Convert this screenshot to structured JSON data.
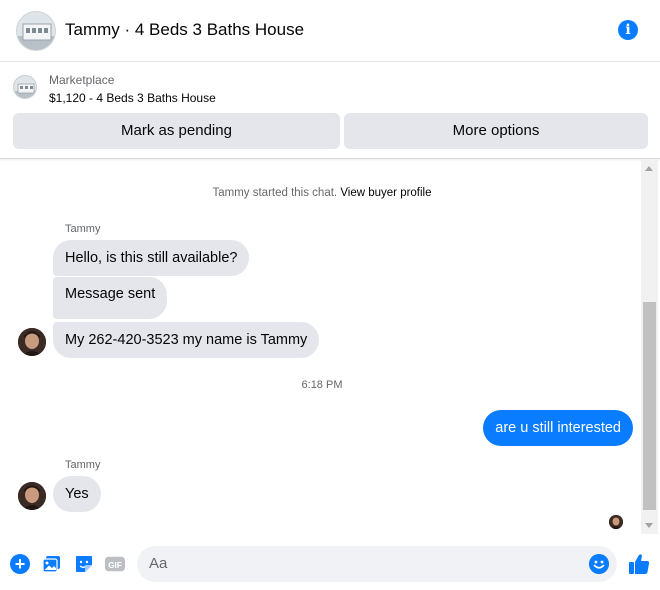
{
  "header": {
    "title": "Tammy · 4 Beds 3 Baths House",
    "avatar_icon": "house-photo",
    "info_icon": "info-icon",
    "info_glyph": "i"
  },
  "marketplace": {
    "label": "Marketplace",
    "listing": "$1,120 - 4 Beds 3 Baths House",
    "mark_pending_label": "Mark as pending",
    "more_options_label": "More options"
  },
  "chat": {
    "started_prefix": "Tammy started this chat.",
    "view_profile_label": "View buyer profile",
    "messages": [
      {
        "sender": "Tammy",
        "text": "Hello, is this still available?"
      },
      {
        "text": "Message sent"
      },
      {
        "text": "My 262-420-3523 my name is Tammy"
      },
      {
        "timestamp": "6:18 PM"
      },
      {
        "outgoing": true,
        "text": "are u still interested"
      },
      {
        "sender": "Tammy",
        "text": "Yes"
      }
    ]
  },
  "composer": {
    "placeholder": "Aa",
    "plus_glyph": "+",
    "gif_label": "GIF",
    "icons": [
      "plus-icon",
      "image-icon",
      "sticker-icon",
      "gif-icon",
      "emoji-icon",
      "thumbs-up-icon"
    ]
  },
  "colors": {
    "accent": "#0a7cff",
    "bubble_incoming": "#e4e6eb",
    "secondary_text": "#65676b"
  }
}
